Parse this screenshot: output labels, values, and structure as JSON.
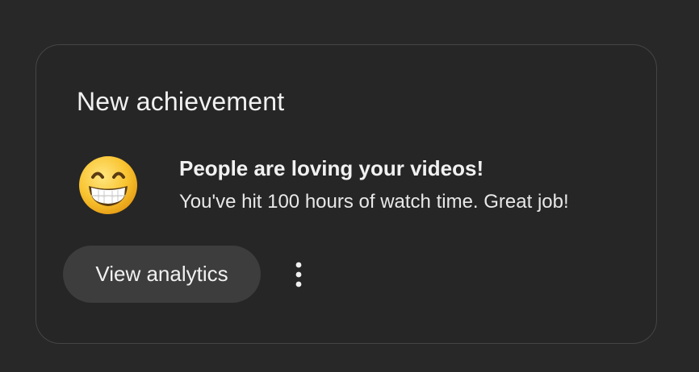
{
  "card": {
    "title": "New achievement",
    "emoji_icon": "grinning-face-with-smiling-eyes-icon",
    "headline": "People are loving your videos!",
    "message": "You've hit 100 hours of watch time. Great job!",
    "action_label": "View analytics",
    "more_icon": "vertical-ellipsis-icon"
  },
  "colors": {
    "background": "#282828",
    "card_border": "#454545",
    "button_bg": "#3d3d3d",
    "text": "#f1f1f1"
  }
}
